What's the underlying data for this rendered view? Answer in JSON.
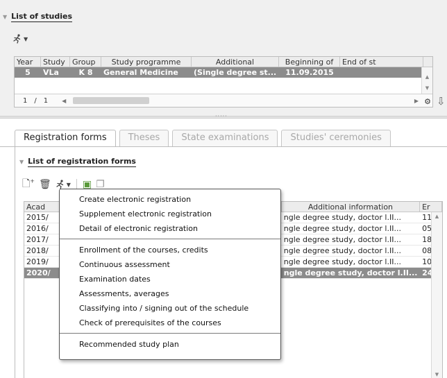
{
  "studies": {
    "section_title": "List of studies",
    "columns": [
      "Year",
      "Study",
      "Group",
      "Study programme",
      "Additional",
      "Beginning of",
      "End of st"
    ],
    "rows": [
      [
        "5",
        "VLa",
        "K 8",
        "General Medicine",
        "(Single degree st...",
        "11.09.2015",
        ""
      ]
    ],
    "pager": {
      "current": "1",
      "separator": "/",
      "total": "1"
    }
  },
  "tabs": [
    {
      "label": "Registration forms",
      "active": true
    },
    {
      "label": "Theses",
      "active": false
    },
    {
      "label": "State examinations",
      "active": false
    },
    {
      "label": "Studies' ceremonies",
      "active": false
    }
  ],
  "registration": {
    "section_title": "List of registration forms",
    "columns": [
      "Acad",
      "Additional information",
      "Er"
    ],
    "rows": [
      {
        "acad": "2015/",
        "additional": "ngle degree study, doctor l.II...",
        "er": "11"
      },
      {
        "acad": "2016/",
        "additional": "ngle degree study, doctor l.II...",
        "er": "05"
      },
      {
        "acad": "2017/",
        "additional": "ngle degree study, doctor l.II...",
        "er": "18"
      },
      {
        "acad": "2018/",
        "additional": "ngle degree study, doctor l.II...",
        "er": "08"
      },
      {
        "acad": "2019/",
        "additional": "ngle degree study, doctor l.II...",
        "er": "10"
      },
      {
        "acad": "2020/",
        "additional": "ngle degree study, doctor l.II...",
        "er": "24",
        "selected": true
      }
    ]
  },
  "context_menu": {
    "groups": [
      [
        "Create electronic registration",
        "Supplement electronic registration",
        "Detail of electronic registration"
      ],
      [
        "Enrollment of the courses, credits",
        "Continuous assessment",
        "Examination dates",
        "Assessments, averages",
        "Classifying into / signing out of the schedule",
        "Check of prerequisites of the courses"
      ],
      [
        "Recommended study plan"
      ]
    ]
  },
  "icons": {
    "section_collapse": "triangle-down-icon",
    "actions": "running-man-icon",
    "add": "add-document-icon",
    "delete": "trash-icon",
    "print": "print-icon",
    "copy": "copy-icon",
    "settings": "gear-icon",
    "export": "download-icon"
  },
  "colors": {
    "selected_row": "#8c8c8c",
    "panel_bg": "#f0f0f0",
    "inactive_tab_text": "#a8a8a8"
  }
}
